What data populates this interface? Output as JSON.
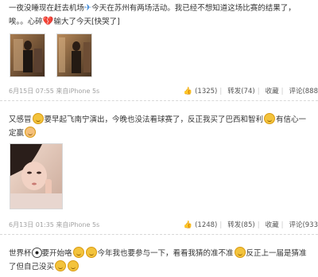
{
  "posts": [
    {
      "line1_a": "一夜没睡现在赶去机场",
      "plane_glyph": "✈",
      "line1_b": "今天在苏州有两场活动。我已经不想知道这场比赛的结果了，",
      "line2_a": "唉。。心碎",
      "broken_glyph": "💔",
      "line2_b": "输大了今天[快哭了]",
      "time": "6月15日 07:55",
      "source": "来自iPhone 5s",
      "likes": "(1325)",
      "repost": "转发(74)",
      "fav": "收藏",
      "comment": "评论(888"
    },
    {
      "line1_a": "又感冒",
      "line1_b": "要早起飞南宁演出，今晚也没法看球赛了，反正我买了巴西和智利",
      "line1_c": "有信心一",
      "line2_a": "定赢",
      "time": "6月13日 01:35",
      "source": "来自iPhone 5s",
      "likes": "(1248)",
      "repost": "转发(85)",
      "fav": "收藏",
      "comment": "评论(933"
    },
    {
      "line1_a": "世界杯",
      "line1_b": "要开始咯",
      "line1_c": "今年我也要参与一下，看看我猜的准不准",
      "line1_d": "反正上一届是猜准",
      "line2_a": "了但自己没买"
    }
  ],
  "colors": {
    "link": "#3a78c8",
    "meta": "#a2a2a2",
    "divider": "#d8d8d8"
  },
  "icons": [
    "plane-icon",
    "broken-heart-icon",
    "like-icon",
    "emoji-face-icon",
    "football-icon"
  ]
}
